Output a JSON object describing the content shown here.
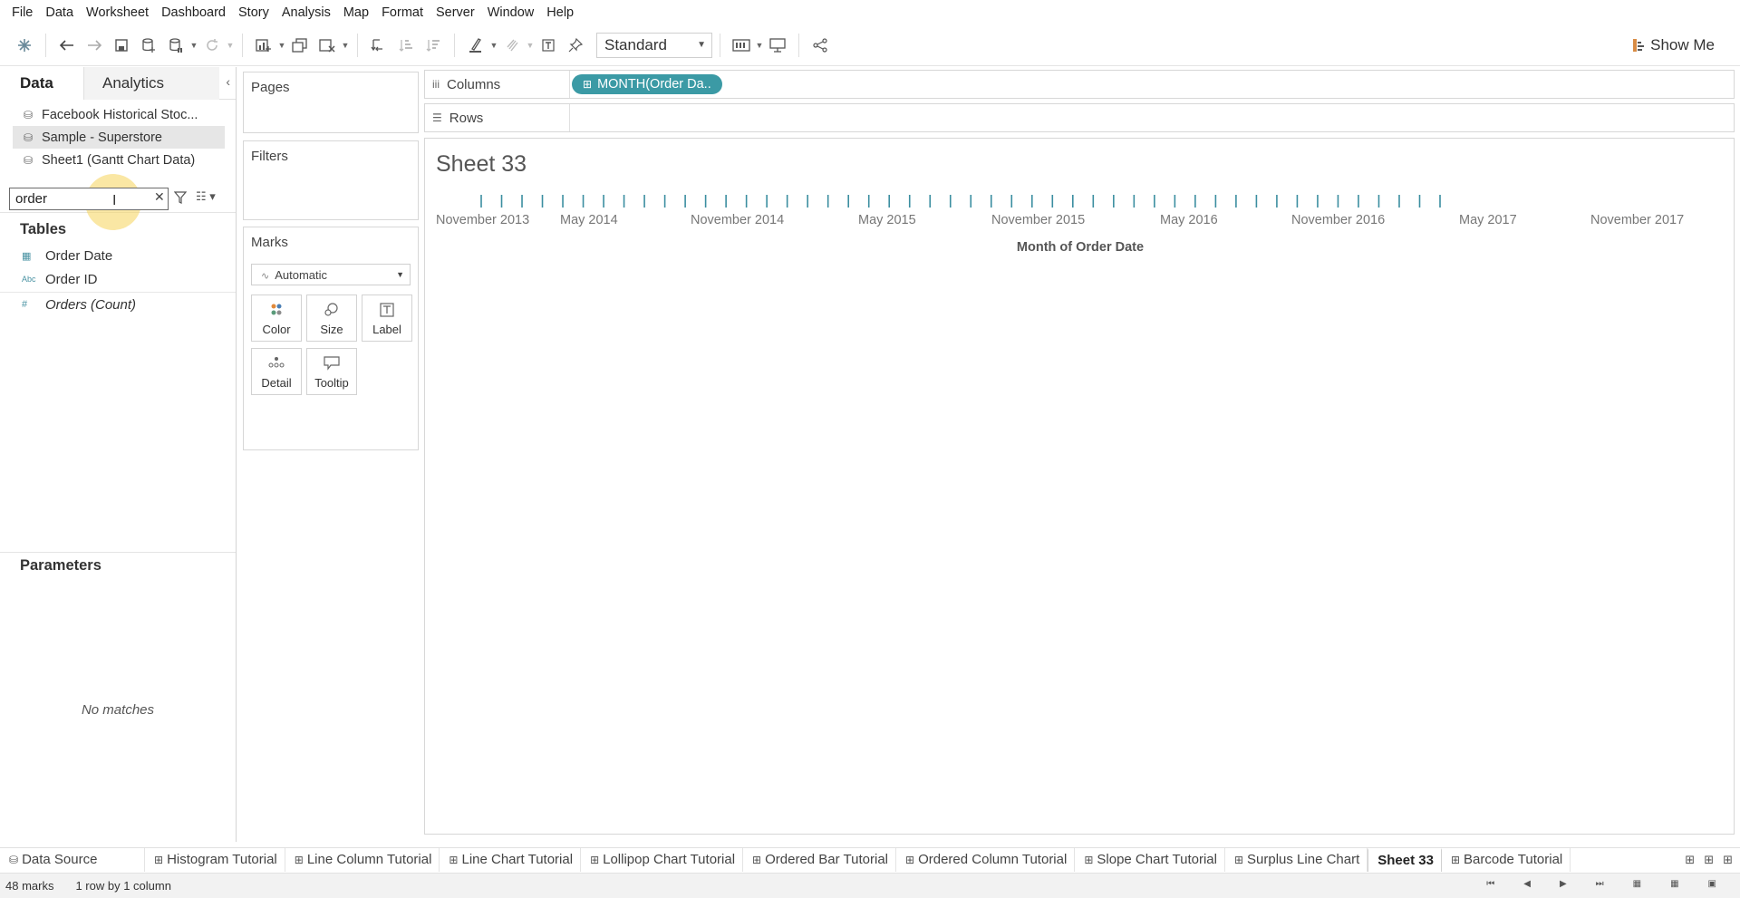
{
  "menu": [
    "File",
    "Data",
    "Worksheet",
    "Dashboard",
    "Story",
    "Analysis",
    "Map",
    "Format",
    "Server",
    "Window",
    "Help"
  ],
  "toolbar": {
    "fit_value": "Standard",
    "show_me_label": "Show Me",
    "icons": [
      "tableau-logo-icon",
      "undo-icon",
      "redo-icon",
      "save-icon",
      "new-datasource-icon",
      "pause-updates-icon",
      "refresh-icon",
      "new-worksheet-icon",
      "duplicate-sheet-icon",
      "clear-sheet-icon",
      "swap-rows-columns-icon",
      "sort-ascending-icon",
      "sort-descending-icon",
      "highlight-icon",
      "group-icon",
      "show-labels-icon",
      "pin-icon",
      "show-cards-icon",
      "presentation-icon",
      "share-icon"
    ]
  },
  "data_pane": {
    "tab_data": "Data",
    "tab_analytics": "Analytics",
    "datasources": [
      {
        "label": "Facebook Historical Stoc..."
      },
      {
        "label": "Sample - Superstore"
      },
      {
        "label": "Sheet1 (Gantt Chart Data)"
      }
    ],
    "search_value": "order",
    "tables_title": "Tables",
    "fields": [
      {
        "icon": "calendar-icon",
        "label": "Order Date"
      },
      {
        "icon": "abc-icon",
        "label": "Order ID"
      },
      {
        "icon": "hash-icon",
        "label": "Orders (Count)"
      }
    ],
    "parameters_title": "Parameters",
    "no_matches": "No matches"
  },
  "cards": {
    "pages": "Pages",
    "filters": "Filters",
    "marks": "Marks",
    "marks_type": "Automatic",
    "mark_buttons": [
      "Color",
      "Size",
      "Label",
      "Detail",
      "Tooltip"
    ]
  },
  "shelves": {
    "columns_label": "Columns",
    "rows_label": "Rows",
    "columns_pill": "MONTH(Order Da.."
  },
  "view": {
    "sheet_title": "Sheet 33",
    "axis_title": "Month of Order Date",
    "tick_labels": [
      "November 2013",
      "May 2014",
      "November 2014",
      "May 2015",
      "November 2015",
      "May 2016",
      "November 2016",
      "May 2017",
      "November 2017"
    ],
    "mark_color": "#3b8ea0",
    "mark_count": 48
  },
  "sheet_tabs": [
    "Data Source",
    "Histogram Tutorial",
    "Line Column Tutorial",
    "Line Chart Tutorial",
    "Lollipop Chart Tutorial",
    "Ordered Bar Tutorial",
    "Ordered Column Tutorial",
    "Slope Chart Tutorial",
    "Surplus Line Chart",
    "Sheet 33",
    "Barcode Tutorial"
  ],
  "active_tab": "Sheet 33",
  "status": {
    "marks": "48 marks",
    "dims": "1 row by 1 column"
  }
}
